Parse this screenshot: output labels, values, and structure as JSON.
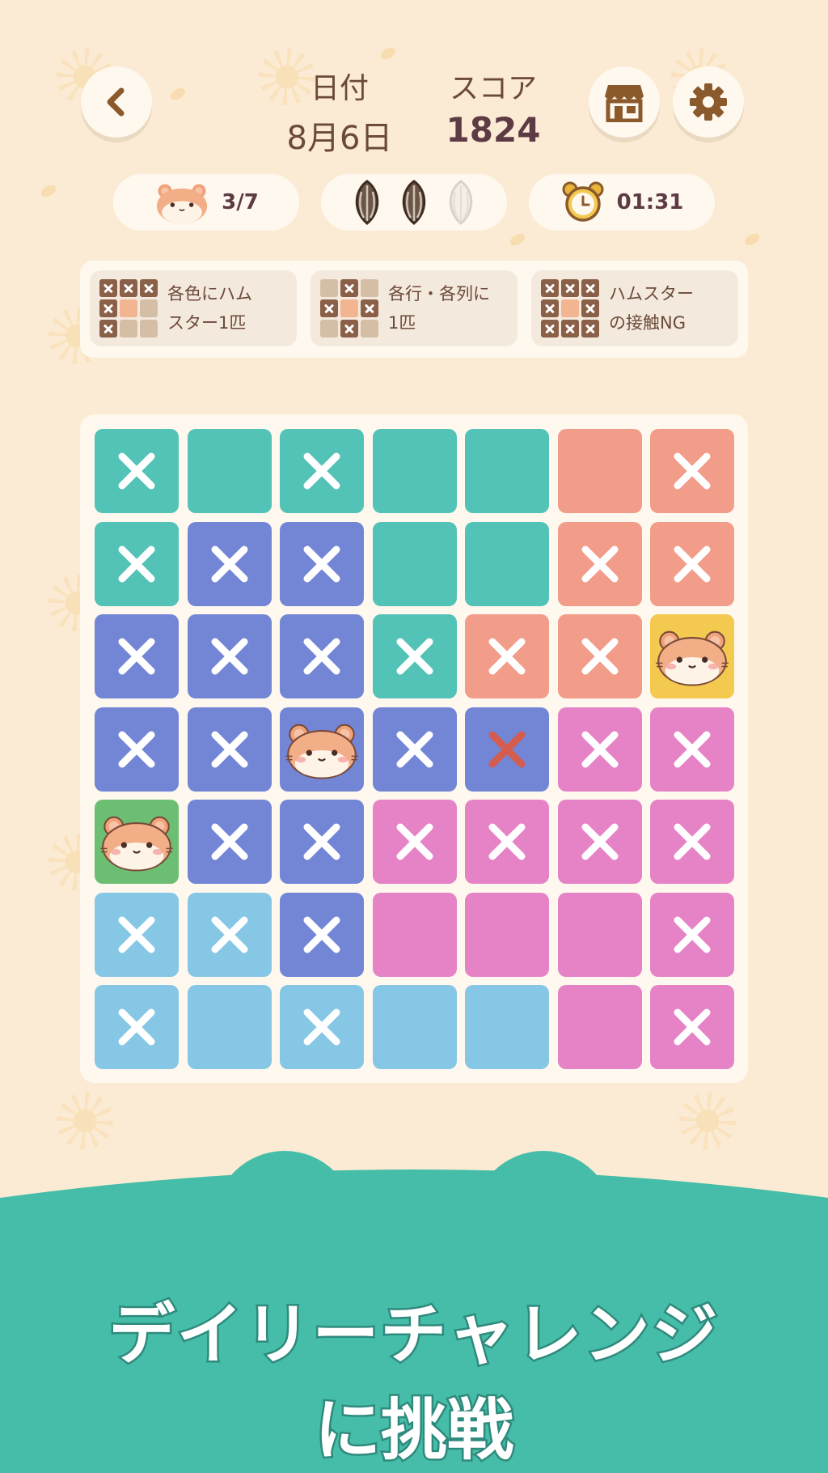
{
  "header": {
    "date_label": "日付",
    "date_value": "8月6日",
    "score_label": "スコア",
    "score_value": "1824"
  },
  "status": {
    "hamsters_found": "3/7",
    "seeds_remaining": 2,
    "seeds_total": 3,
    "timer": "01:31"
  },
  "rules": [
    {
      "text": "各色にハム\nスター1匹"
    },
    {
      "text": "各行・各列に\n1匹"
    },
    {
      "text": "ハムスター\nの接触NG"
    }
  ],
  "colors": {
    "teal": "#52c3b6",
    "salmon": "#f29c8a",
    "indigo": "#7386d6",
    "pink": "#e683c6",
    "sky": "#86c7e6",
    "yellow": "#f3c94f",
    "green": "#6cbf72",
    "background": "#fcebd4",
    "footer": "#46bda8"
  },
  "board": {
    "rows": [
      [
        {
          "c": "teal",
          "m": "x"
        },
        {
          "c": "teal",
          "m": ""
        },
        {
          "c": "teal",
          "m": "x"
        },
        {
          "c": "teal",
          "m": ""
        },
        {
          "c": "teal",
          "m": ""
        },
        {
          "c": "salmon",
          "m": ""
        },
        {
          "c": "salmon",
          "m": "x"
        }
      ],
      [
        {
          "c": "teal",
          "m": "x"
        },
        {
          "c": "indigo",
          "m": "x"
        },
        {
          "c": "indigo",
          "m": "x"
        },
        {
          "c": "teal",
          "m": ""
        },
        {
          "c": "teal",
          "m": ""
        },
        {
          "c": "salmon",
          "m": "x"
        },
        {
          "c": "salmon",
          "m": "x"
        }
      ],
      [
        {
          "c": "indigo",
          "m": "x"
        },
        {
          "c": "indigo",
          "m": "x"
        },
        {
          "c": "indigo",
          "m": "x"
        },
        {
          "c": "teal",
          "m": "x"
        },
        {
          "c": "salmon",
          "m": "x"
        },
        {
          "c": "salmon",
          "m": "x"
        },
        {
          "c": "yellow",
          "m": "hamster"
        }
      ],
      [
        {
          "c": "indigo",
          "m": "x"
        },
        {
          "c": "indigo",
          "m": "x"
        },
        {
          "c": "indigo",
          "m": "hamster"
        },
        {
          "c": "indigo",
          "m": "x"
        },
        {
          "c": "indigo",
          "m": "redx"
        },
        {
          "c": "pink",
          "m": "x"
        },
        {
          "c": "pink",
          "m": "x"
        }
      ],
      [
        {
          "c": "green",
          "m": "hamster"
        },
        {
          "c": "indigo",
          "m": "x"
        },
        {
          "c": "indigo",
          "m": "x"
        },
        {
          "c": "pink",
          "m": "x"
        },
        {
          "c": "pink",
          "m": "x"
        },
        {
          "c": "pink",
          "m": "x"
        },
        {
          "c": "pink",
          "m": "x"
        }
      ],
      [
        {
          "c": "sky",
          "m": "x"
        },
        {
          "c": "sky",
          "m": "x"
        },
        {
          "c": "indigo",
          "m": "x"
        },
        {
          "c": "pink",
          "m": ""
        },
        {
          "c": "pink",
          "m": ""
        },
        {
          "c": "pink",
          "m": ""
        },
        {
          "c": "pink",
          "m": "x"
        }
      ],
      [
        {
          "c": "sky",
          "m": "x"
        },
        {
          "c": "sky",
          "m": ""
        },
        {
          "c": "sky",
          "m": "x"
        },
        {
          "c": "sky",
          "m": ""
        },
        {
          "c": "sky",
          "m": ""
        },
        {
          "c": "pink",
          "m": ""
        },
        {
          "c": "pink",
          "m": "x"
        }
      ]
    ]
  },
  "banner": {
    "line1": "デイリーチャレンジ",
    "line2": "に挑戦"
  },
  "icons": {
    "back": "chevron-left-icon",
    "shop": "shop-icon",
    "settings": "gear-icon",
    "hamster": "hamster-icon",
    "seed": "sunflower-seed-icon",
    "timer": "alarm-clock-icon"
  }
}
